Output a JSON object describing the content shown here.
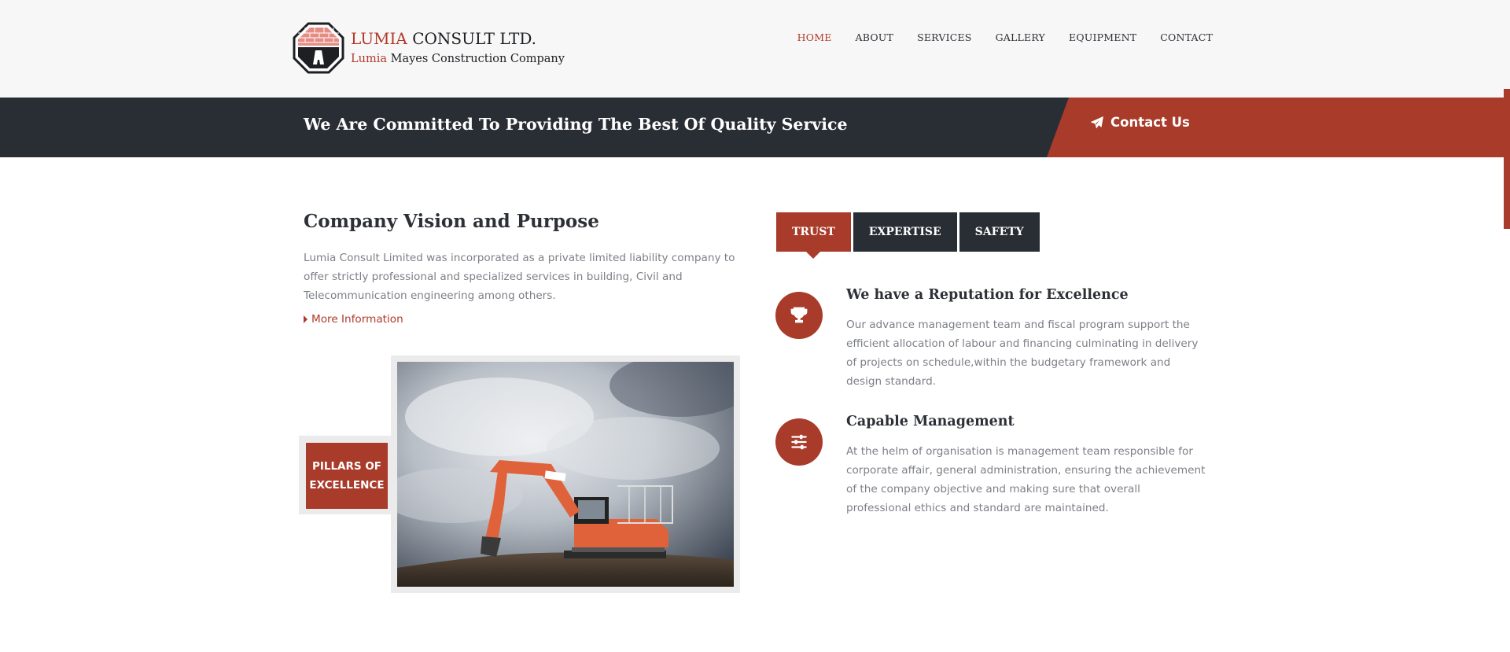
{
  "brand": {
    "title_accent": "LUMIA",
    "title_rest": " CONSULT LTD.",
    "subtitle_accent": "Lumia",
    "subtitle_rest": " Mayes Construction Company",
    "accent_color": "#b1392a",
    "dark_color": "#292e35"
  },
  "nav": {
    "items": [
      {
        "label": "HOME",
        "active": true
      },
      {
        "label": "ABOUT"
      },
      {
        "label": "SERVICES"
      },
      {
        "label": "GALLERY"
      },
      {
        "label": "EQUIPMENT"
      },
      {
        "label": "CONTACT"
      }
    ]
  },
  "banner": {
    "headline": "We Are Committed To Providing The Best Of Quality Service",
    "cta_label": "Contact Us",
    "cta_icon": "paper-plane-icon"
  },
  "vision": {
    "title": "Company Vision and Purpose",
    "body": "Lumia Consult Limited was incorporated as a private limited liability company to offer strictly professional and specialized services in building, Civil and Telecommunication engineering among others.",
    "link": "More Information"
  },
  "pillars": {
    "line1": "PILLARS OF",
    "line2": "EXCELLENCE"
  },
  "tabs": {
    "items": [
      {
        "label": "TRUST",
        "active": true
      },
      {
        "label": "EXPERTISE"
      },
      {
        "label": "SAFETY"
      }
    ]
  },
  "features": [
    {
      "icon": "trophy-icon",
      "title": "We have a Reputation for Excellence",
      "text": "Our advance management team and fiscal program support the efficient allocation of labour and financing culminating in delivery of projects on schedule,within the budgetary framework and design standard."
    },
    {
      "icon": "sliders-icon",
      "title": "Capable Management",
      "text": "At the helm of organisation is management team responsible for corporate affair, general administration, ensuring the achievement of the company objective and making sure that overall professional ethics and standard are maintained."
    }
  ]
}
